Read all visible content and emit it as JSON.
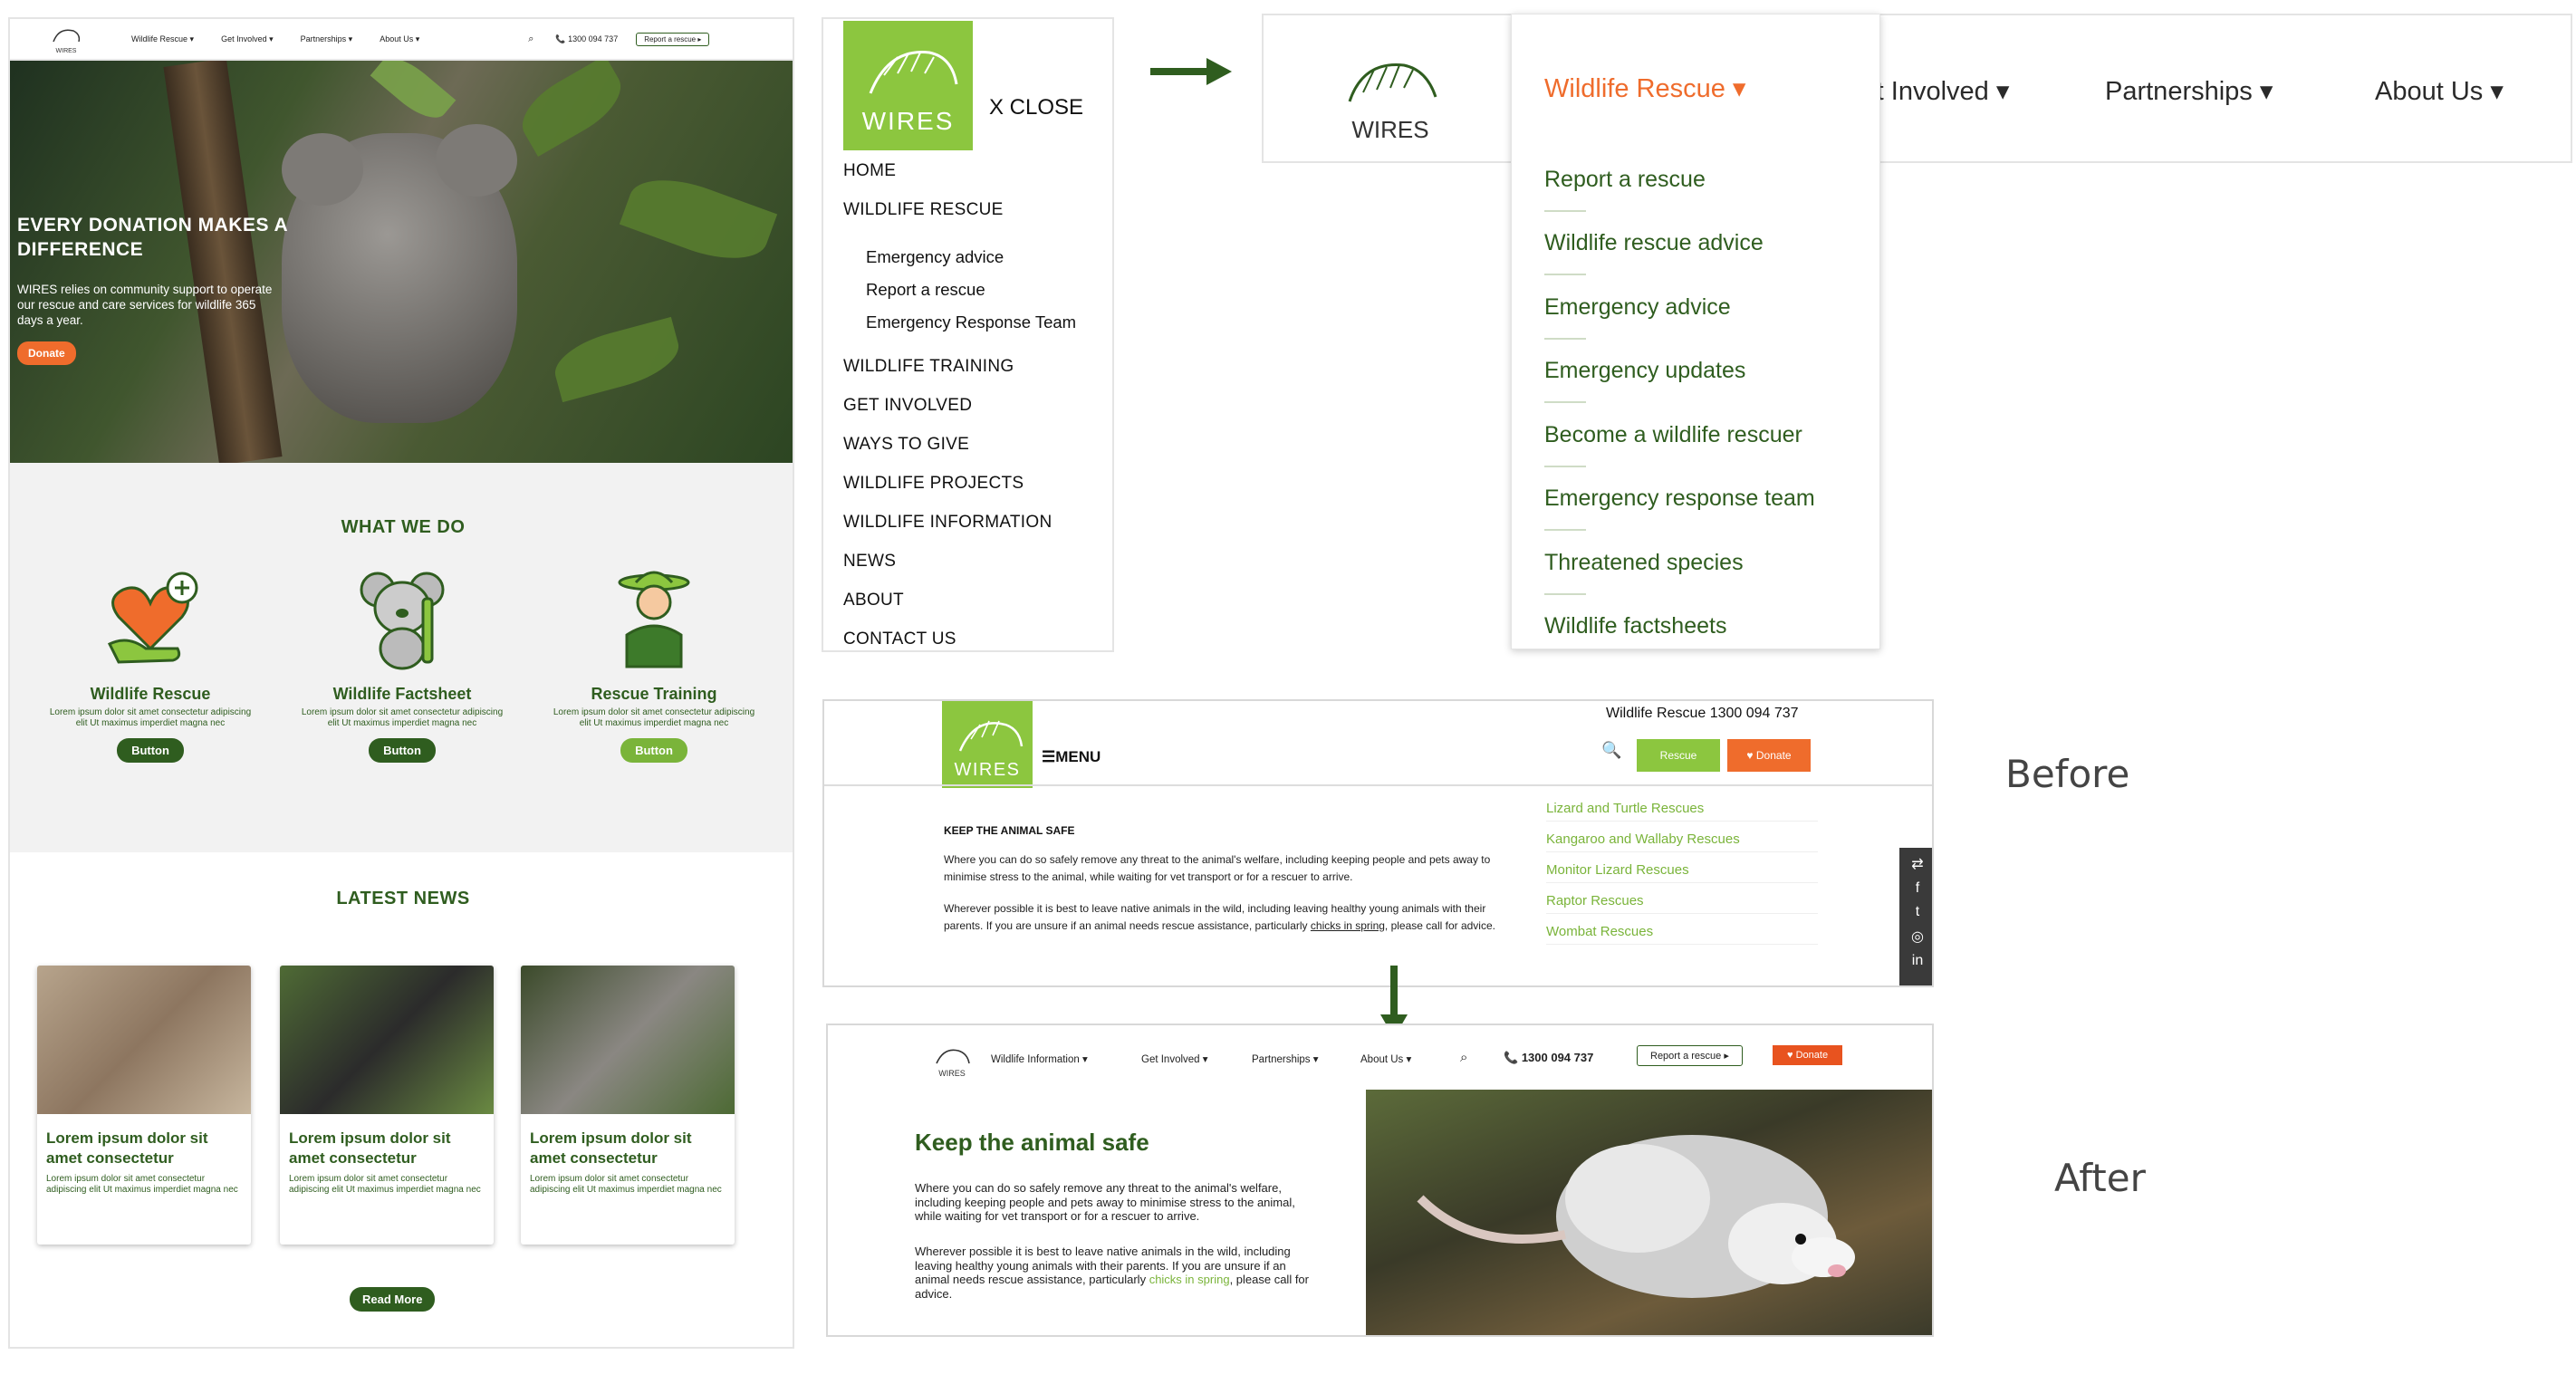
{
  "colors": {
    "brand_green": "#2f5d1f",
    "light_green": "#8cc63f",
    "accent_orange": "#ef6c2c",
    "link_green": "#7ab43a"
  },
  "home": {
    "nav": {
      "logo_text": "WIRES",
      "items": [
        "Wildlife Rescue",
        "Get Involved",
        "Partnerships",
        "About Us"
      ],
      "phone": "1300 094 737",
      "report": "Report a rescue ▸"
    },
    "hero": {
      "title": "EVERY DONATION MAKES A DIFFERENCE",
      "body": "WIRES relies on community support to operate our rescue and care services for wildlife 365 days a year.",
      "cta": "Donate"
    },
    "what_we_do": {
      "title": "WHAT WE DO",
      "services": [
        {
          "title": "Wildlife Rescue",
          "desc": "Lorem ipsum dolor sit amet consectetur adipiscing elit Ut maximus imperdiet magna nec",
          "button": "Button"
        },
        {
          "title": "Wildlife Factsheet",
          "desc": "Lorem ipsum dolor sit amet consectetur adipiscing elit Ut maximus imperdiet magna nec",
          "button": "Button"
        },
        {
          "title": "Rescue Training",
          "desc": "Lorem ipsum dolor sit amet consectetur adipiscing elit Ut maximus imperdiet magna nec",
          "button": "Button"
        }
      ]
    },
    "news": {
      "title": "LATEST NEWS",
      "cards": [
        {
          "title": "Lorem ipsum dolor sit amet consectetur",
          "desc": "Lorem ipsum dolor sit amet consectetur adipiscing elit Ut maximus imperdiet magna nec"
        },
        {
          "title": "Lorem ipsum dolor sit amet consectetur",
          "desc": "Lorem ipsum dolor sit amet consectetur adipiscing elit Ut maximus imperdiet magna nec"
        },
        {
          "title": "Lorem ipsum dolor sit amet consectetur",
          "desc": "Lorem ipsum dolor sit amet consectetur adipiscing elit Ut maximus imperdiet magna nec"
        }
      ],
      "read_more": "Read More"
    }
  },
  "mobile_menu": {
    "logo_text": "WIRES",
    "close": "X CLOSE",
    "items": [
      "HOME",
      "WILDLIFE RESCUE",
      "WILDLIFE TRAINING",
      "GET INVOLVED",
      "WAYS TO GIVE",
      "WILDLIFE PROJECTS",
      "WILDLIFE INFORMATION",
      "NEWS",
      "ABOUT",
      "CONTACT US"
    ],
    "sub_items": [
      "Emergency advice",
      "Report a rescue",
      "Emergency Response Team"
    ]
  },
  "desktop_menu": {
    "logo_text": "WIRES",
    "tabs": [
      "Wildlife Rescue",
      "Get Involved",
      "Partnerships",
      "About Us"
    ],
    "dropdown": [
      "Report a rescue",
      "Wildlife rescue advice",
      "Emergency advice",
      "Emergency updates",
      "Become a wildlife rescuer",
      "Emergency response team",
      "Threatened species",
      "Wildlife factsheets"
    ]
  },
  "before": {
    "logo_text": "WIRES",
    "menu": "☰MENU",
    "top_text": "Wildlife Rescue 1300 094 737",
    "rescue_btn": "Rescue",
    "donate_btn": "Donate",
    "heading": "KEEP THE ANIMAL SAFE",
    "para1": "Where you can do so safely remove any threat to the animal's welfare, including keeping people and pets away to minimise stress to the animal, while waiting for vet transport or for a rescuer to arrive.",
    "para2_a": "Wherever possible it is best to leave native animals in the wild, including leaving healthy young animals with their parents. If you are unsure if an animal needs rescue assistance, particularly ",
    "para2_link": "chicks in spring",
    "para2_b": ", please call for advice.",
    "links": [
      "Lizard and Turtle Rescues",
      "Kangaroo and Wallaby Rescues",
      "Monitor Lizard Rescues",
      "Raptor Rescues",
      "Wombat Rescues"
    ],
    "label": "Before"
  },
  "after": {
    "logo_text": "WIRES",
    "nav": [
      "Wildlife Information",
      "Get Involved",
      "Partnerships",
      "About Us"
    ],
    "phone": "1300 094 737",
    "report": "Report a rescue ▸",
    "donate": "Donate",
    "heading": "Keep the animal safe",
    "para1": "Where you can do so safely remove any threat to the animal's welfare, including keeping people and pets away to minimise stress to the animal, while waiting for vet transport or for a rescuer to arrive.",
    "para2_a": "Wherever possible it is best to leave native animals in the wild, including leaving healthy young animals with their parents. If you are unsure if an animal needs rescue assistance, particularly ",
    "para2_link": "chicks in spring",
    "para2_b": ", please call for advice.",
    "label": "After"
  }
}
